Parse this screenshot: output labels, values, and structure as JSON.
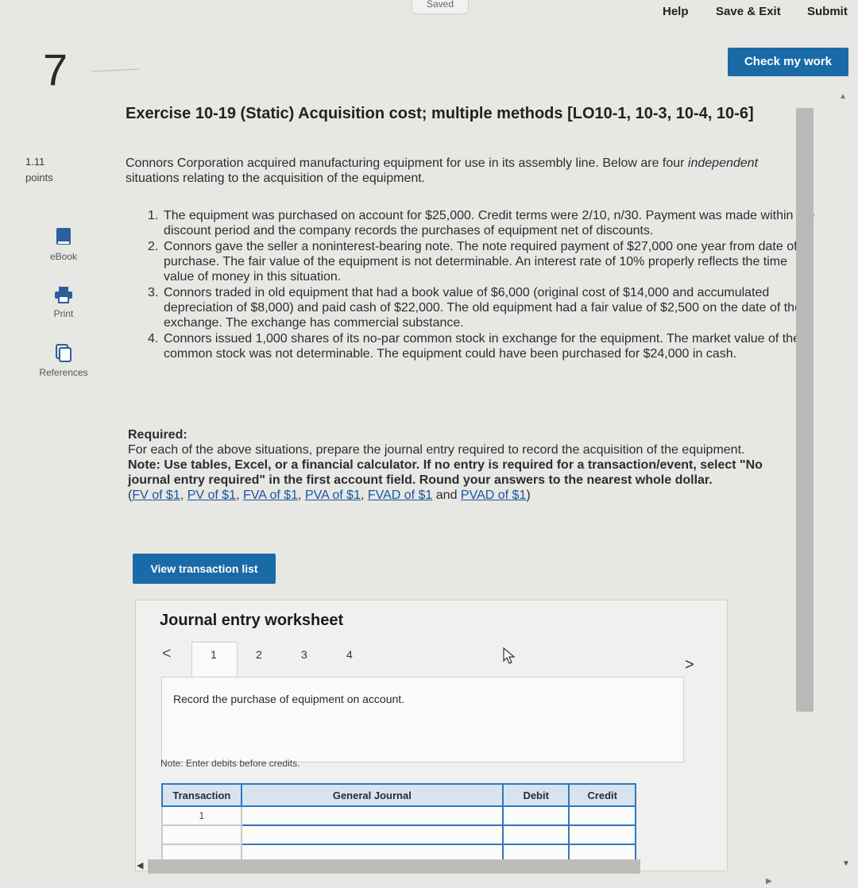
{
  "header": {
    "saved": "Saved",
    "help": "Help",
    "save_exit": "Save & Exit",
    "submit": "Submit",
    "check_my_work": "Check my work"
  },
  "question": {
    "number": "7",
    "points_value": "1.11",
    "points_label": "points",
    "title": "Exercise 10-19 (Static) Acquisition cost; multiple methods [LO10-1, 10-3, 10-4, 10-6]"
  },
  "sidebar": {
    "items": [
      {
        "label": "eBook",
        "icon": "book-icon"
      },
      {
        "label": "Print",
        "icon": "printer-icon"
      },
      {
        "label": "References",
        "icon": "references-icon"
      }
    ]
  },
  "content": {
    "intro_part1": "Connors Corporation acquired manufacturing equipment for use in its assembly line. Below are four ",
    "intro_italic": "independent",
    "intro_part2": " situations relating to the acquisition of the equipment.",
    "items": [
      {
        "num": "1.",
        "text": "The equipment was purchased on account for $25,000. Credit terms were 2/10, n/30. Payment was made within the discount period and the company records the purchases of equipment net of discounts."
      },
      {
        "num": "2.",
        "text": "Connors gave the seller a noninterest-bearing note. The note required payment of $27,000 one year from date of purchase. The fair value of the equipment is not determinable. An interest rate of 10% properly reflects the time value of money in this situation."
      },
      {
        "num": "3.",
        "text": "Connors traded in old equipment that had a book value of $6,000 (original cost of $14,000 and accumulated depreciation of $8,000) and paid cash of $22,000. The old equipment had a fair value of $2,500 on the date of the exchange. The exchange has commercial substance."
      },
      {
        "num": "4.",
        "text": "Connors issued 1,000 shares of its no-par common stock in exchange for the equipment. The market value of the common stock was not determinable. The equipment could have been purchased for $24,000 in cash."
      }
    ],
    "required_label": "Required:",
    "required_text": "For each of the above situations, prepare the journal entry required to record the acquisition of the equipment.",
    "note_text": "Note: Use tables, Excel, or a financial calculator. If no entry is required for a transaction/event, select \"No journal entry required\" in the first account field. Round your answers to the nearest whole dollar.",
    "links": [
      "FV of $1",
      "PV of $1",
      "FVA of $1",
      "PVA of $1",
      "FVAD of $1",
      "PVAD of $1"
    ],
    "link_sep": ", ",
    "link_and": " and ",
    "paren_open": "(",
    "paren_close": ")"
  },
  "worksheet": {
    "view_button": "View transaction list",
    "title": "Journal entry worksheet",
    "pages": [
      "1",
      "2",
      "3",
      "4"
    ],
    "prev": "<",
    "next": ">",
    "prompt": "Record the purchase of equipment on account.",
    "note": "Note: Enter debits before credits.",
    "table": {
      "headers": [
        "Transaction",
        "General Journal",
        "Debit",
        "Credit"
      ],
      "rows": [
        [
          "1",
          "",
          "",
          ""
        ],
        [
          "",
          "",
          "",
          ""
        ],
        [
          "",
          "",
          "",
          ""
        ]
      ]
    }
  }
}
